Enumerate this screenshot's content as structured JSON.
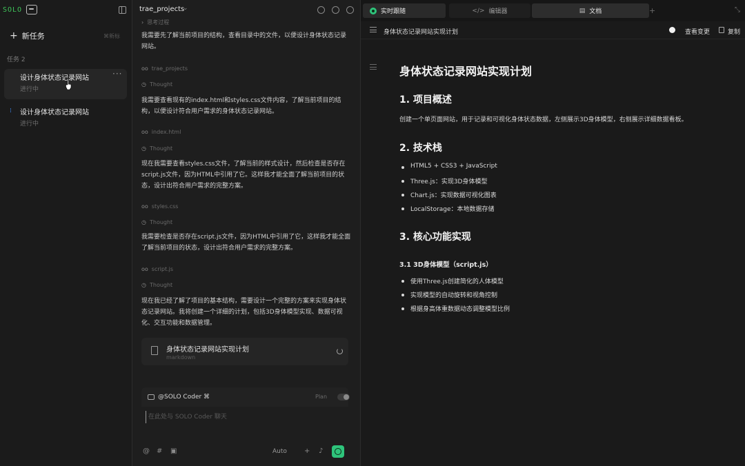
{
  "sidebar": {
    "logo_text": "SOLO",
    "new_task_label": "新任务",
    "new_task_shortcut": "⌘新标",
    "tasks_header": "任务  2",
    "tasks": [
      {
        "title": "设计身体状态记录网站",
        "status": "进行中",
        "active": true
      },
      {
        "title": "设计身体状态记录网站",
        "status": "进行中",
        "active": false
      }
    ],
    "more_label": "···"
  },
  "chat": {
    "project_name": "trae_projects",
    "messages": [
      {
        "kind": "tool",
        "label": "思考过程"
      },
      {
        "kind": "text",
        "text": "我需要先了解当前项目的结构，查看目录中的文件，以便设计身体状态记录网站。"
      },
      {
        "kind": "tool",
        "label": "trae_projects"
      },
      {
        "kind": "tool",
        "label": "Thought"
      },
      {
        "kind": "text",
        "text": "我需要查看现有的index.html和styles.css文件内容，了解当前项目的结构，以便设计符合用户需求的身体状态记录网站。"
      },
      {
        "kind": "tool",
        "label": "index.html"
      },
      {
        "kind": "tool",
        "label": "Thought"
      },
      {
        "kind": "text",
        "text": "现在我需要查看styles.css文件，了解当前的样式设计，然后检查是否存在script.js文件，因为HTML中引用了它。这样我才能全面了解当前项目的状态，设计出符合用户需求的完整方案。"
      },
      {
        "kind": "tool",
        "label": "styles.css"
      },
      {
        "kind": "tool",
        "label": "Thought"
      },
      {
        "kind": "text",
        "text": "我需要检查是否存在script.js文件，因为HTML中引用了它，这样我才能全面了解当前项目的状态，设计出符合用户需求的完整方案。"
      },
      {
        "kind": "tool",
        "label": "script.js"
      },
      {
        "kind": "tool",
        "label": "Thought"
      },
      {
        "kind": "text",
        "text": "现在我已经了解了项目的基本结构，需要设计一个完整的方案来实现身体状态记录网站。我将创建一个详细的计划，包括3D身体模型实现、数据可视化、交互功能和数据管理。"
      }
    ],
    "plan_card": {
      "title": "身体状态记录网站实现计划",
      "type": "markdown"
    },
    "input": {
      "agent": "@SOLO Coder ⌘",
      "plan_label": "Plan",
      "placeholder": "在此处与 SOLO Coder 聊天",
      "mode": "Auto"
    }
  },
  "right": {
    "tabs": {
      "follow": "实时跟随",
      "editor": "编辑器",
      "docs": "文档"
    },
    "doc_file": "身体状态记录网站实现计划",
    "view_changes": "查看变更",
    "copy": "复制",
    "doc": {
      "title": "身体状态记录网站实现计划",
      "s1_heading": "1. 项目概述",
      "s1_text": "创建一个单页面网站，用于记录和可视化身体状态数据，左侧展示3D身体模型，右侧展示详细数据看板。",
      "s2_heading": "2. 技术栈",
      "s2_items": [
        "HTML5 + CSS3 + JavaScript",
        "Three.js：实现3D身体模型",
        "Chart.js：实现数据可视化图表",
        "LocalStorage：本地数据存储"
      ],
      "s3_heading": "3. 核心功能实现",
      "s31_heading": "3.1 3D身体模型（script.js）",
      "s31_items": [
        "使用Three.js创建简化的人体模型",
        "实现模型的自动旋转和视角控制",
        "根据身高体重数据动态调整模型比例"
      ]
    }
  },
  "colors": {
    "accent_green": "#2ec47b",
    "background": "#1e1e1e"
  }
}
